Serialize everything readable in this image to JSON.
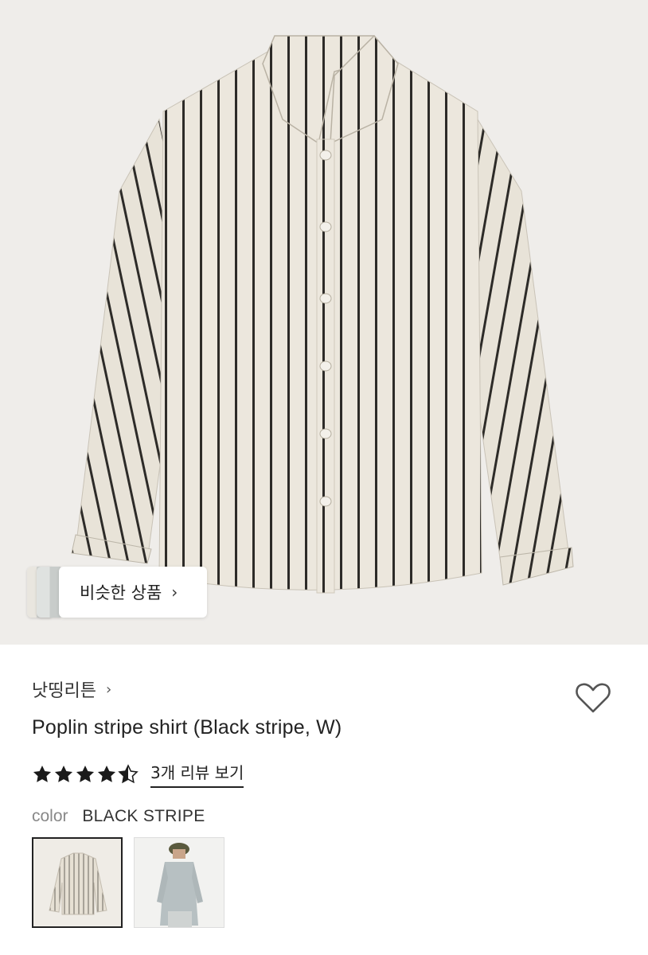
{
  "hero": {
    "image_alt": "shirt-photo",
    "similar_label": "비슷한 상품",
    "similar_chevron": "›"
  },
  "product": {
    "brand": "낫띵리튼",
    "brand_chevron": "›",
    "title": "Poplin stripe shirt (Black stripe, W)",
    "rating": 4.5,
    "stars_max": 5,
    "review_link": "3개 리뷰 보기",
    "color_label": "color",
    "color_value": "BLACK STRIPE",
    "wishlist_icon": "heart-outline-icon"
  },
  "swatches": [
    {
      "name": "shirt-flat",
      "selected": true
    },
    {
      "name": "model-wearing-shirt",
      "selected": false
    }
  ],
  "colors": {
    "stripe": "#2d2b28",
    "fabric": "#ece7dd",
    "background": "#efedea",
    "star": "#1a1a1a"
  }
}
